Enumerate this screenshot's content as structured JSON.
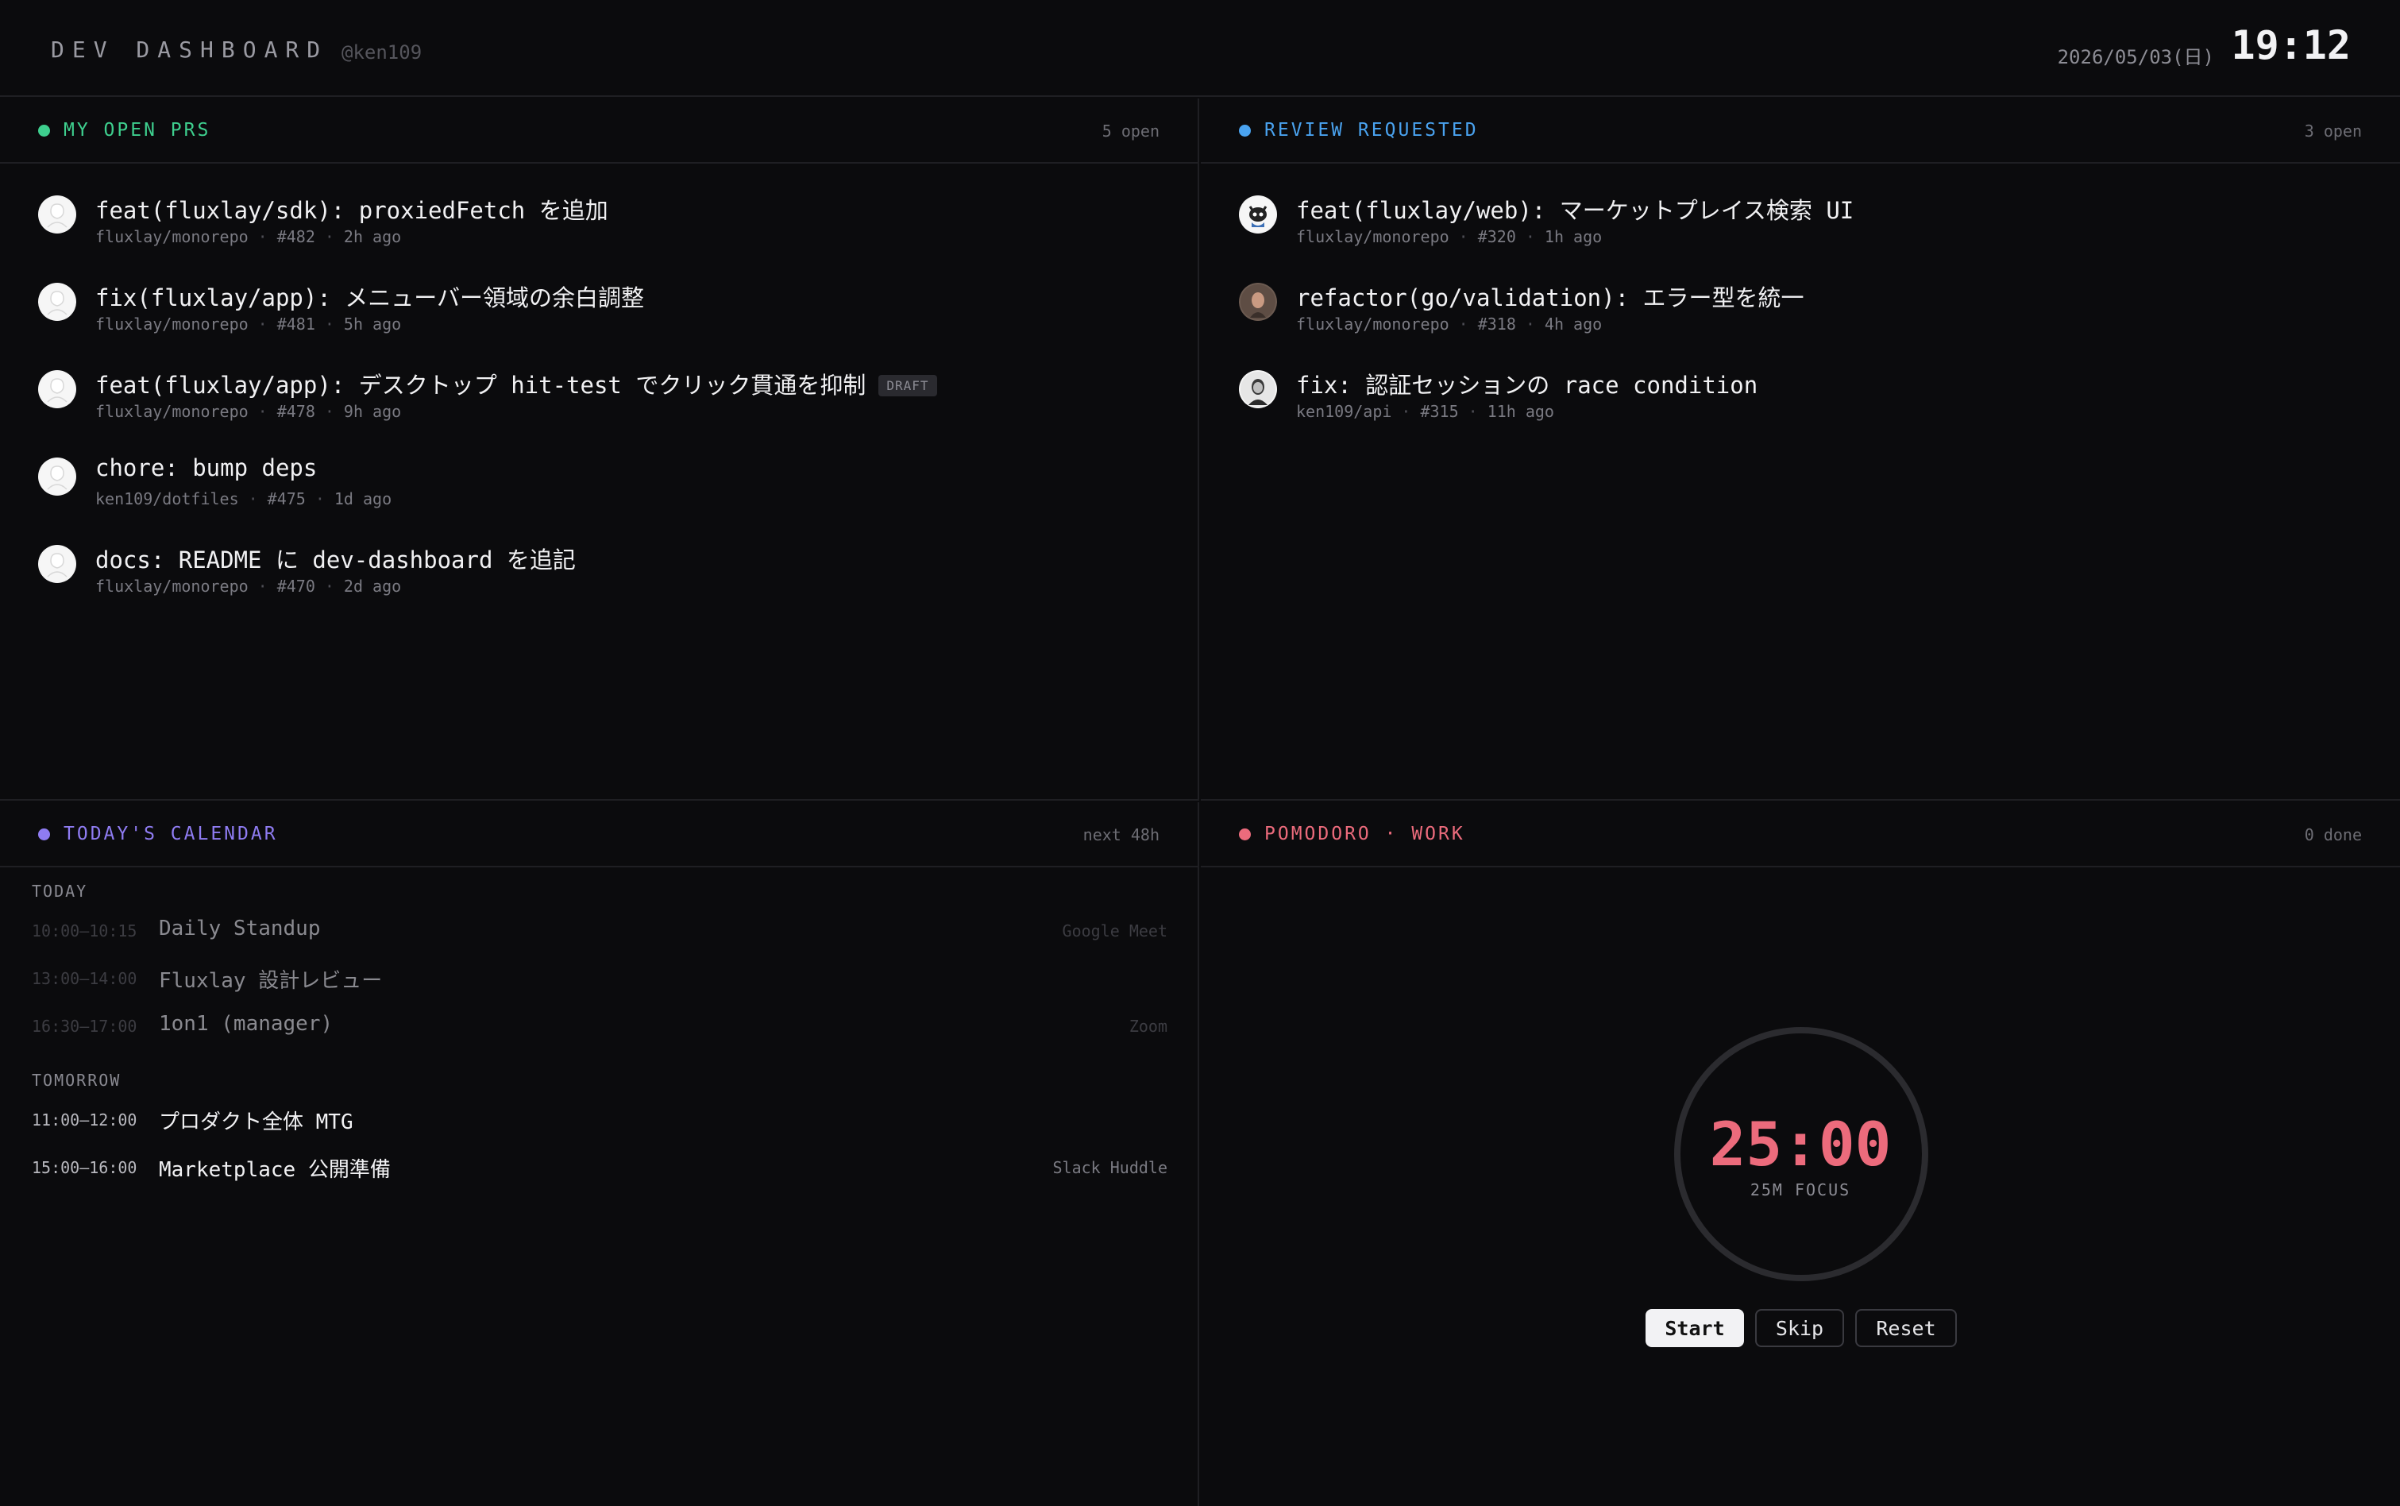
{
  "header": {
    "title": "DEV DASHBOARD",
    "handle": "@ken109",
    "date": "2026/05/03(日)",
    "time": "19:12"
  },
  "panels": {
    "my_prs": {
      "title": "MY OPEN PRS",
      "count": "5 open",
      "color": "#3ecf8e",
      "items": [
        {
          "title": "feat(fluxlay/sdk): proxiedFetch を追加",
          "repo": "fluxlay/monorepo",
          "number": "#482",
          "age": "2h ago",
          "badge": ""
        },
        {
          "title": "fix(fluxlay/app): メニューバー領域の余白調整",
          "repo": "fluxlay/monorepo",
          "number": "#481",
          "age": "5h ago",
          "badge": ""
        },
        {
          "title": "feat(fluxlay/app): デスクトップ hit-test でクリック貫通を抑制",
          "repo": "fluxlay/monorepo",
          "number": "#478",
          "age": "9h ago",
          "badge": "DRAFT"
        },
        {
          "title": "chore: bump deps",
          "repo": "ken109/dotfiles",
          "number": "#475",
          "age": "1d ago",
          "badge": ""
        },
        {
          "title": "docs: README に dev-dashboard を追記",
          "repo": "fluxlay/monorepo",
          "number": "#470",
          "age": "2d ago",
          "badge": ""
        }
      ]
    },
    "review": {
      "title": "REVIEW REQUESTED",
      "count": "3 open",
      "color": "#4aa3f0",
      "items": [
        {
          "title": "feat(fluxlay/web): マーケットプレイス検索 UI",
          "repo": "fluxlay/monorepo",
          "number": "#320",
          "age": "1h ago"
        },
        {
          "title": "refactor(go/validation): エラー型を統一",
          "repo": "fluxlay/monorepo",
          "number": "#318",
          "age": "4h ago"
        },
        {
          "title": "fix: 認証セッションの race condition",
          "repo": "ken109/api",
          "number": "#315",
          "age": "11h ago"
        }
      ]
    },
    "calendar": {
      "title": "TODAY'S CALENDAR",
      "count": "next 48h",
      "color": "#8f7cf2",
      "days": [
        {
          "label": "TODAY",
          "events": [
            {
              "time": "10:00–10:15",
              "title": "Daily Standup",
              "location": "Google Meet"
            },
            {
              "time": "13:00–14:00",
              "title": "Fluxlay 設計レビュー",
              "location": ""
            },
            {
              "time": "16:30–17:00",
              "title": "1on1 (manager)",
              "location": "Zoom"
            }
          ]
        },
        {
          "label": "TOMORROW",
          "events": [
            {
              "time": "11:00–12:00",
              "title": "プロダクト全体 MTG",
              "location": ""
            },
            {
              "time": "15:00–16:00",
              "title": "Marketplace 公開準備",
              "location": "Slack Huddle"
            }
          ]
        }
      ]
    },
    "pomodoro": {
      "title": "POMODORO · WORK",
      "count": "0 done",
      "color": "#ec6b7c",
      "timer": "25:00",
      "subtitle": "25M FOCUS",
      "buttons": {
        "start": "Start",
        "skip": "Skip",
        "reset": "Reset"
      }
    }
  }
}
